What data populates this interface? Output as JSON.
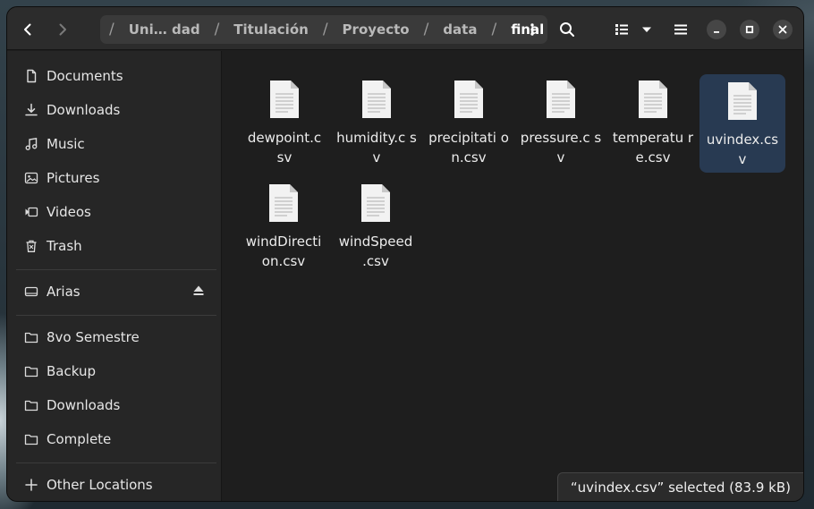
{
  "path": {
    "segments": [
      "Uni… dad",
      "Titulación",
      "Proyecto",
      "data",
      "final"
    ]
  },
  "sidebar": {
    "places": [
      {
        "label": "Documents",
        "icon": "document-icon"
      },
      {
        "label": "Downloads",
        "icon": "download-icon"
      },
      {
        "label": "Music",
        "icon": "music-icon"
      },
      {
        "label": "Pictures",
        "icon": "picture-icon"
      },
      {
        "label": "Videos",
        "icon": "video-icon"
      },
      {
        "label": "Trash",
        "icon": "trash-icon"
      }
    ],
    "devices": [
      {
        "label": "Arias",
        "icon": "drive-icon"
      }
    ],
    "bookmarks": [
      {
        "label": "8vo Semestre",
        "icon": "folder-icon"
      },
      {
        "label": "Backup",
        "icon": "folder-icon"
      },
      {
        "label": "Downloads",
        "icon": "folder-icon"
      },
      {
        "label": "Complete",
        "icon": "folder-icon"
      }
    ],
    "other_locations": "Other Locations"
  },
  "files": [
    {
      "name": "dewpoint.c sv"
    },
    {
      "name": "humidity.c sv"
    },
    {
      "name": "precipitati on.csv"
    },
    {
      "name": "pressure.c sv"
    },
    {
      "name": "temperatu re.csv"
    },
    {
      "name": "uvindex.cs v",
      "selected": true
    },
    {
      "name": "windDirecti on.csv"
    },
    {
      "name": "windSpeed .csv"
    }
  ],
  "status": "“uvindex.csv” selected  (83.9 kB)",
  "colors": {
    "window_bg": "#1e1e1e",
    "headerbar_bg": "#2c2c2c",
    "sidebar_bg": "#262626",
    "selection_bg": "#283a52"
  }
}
